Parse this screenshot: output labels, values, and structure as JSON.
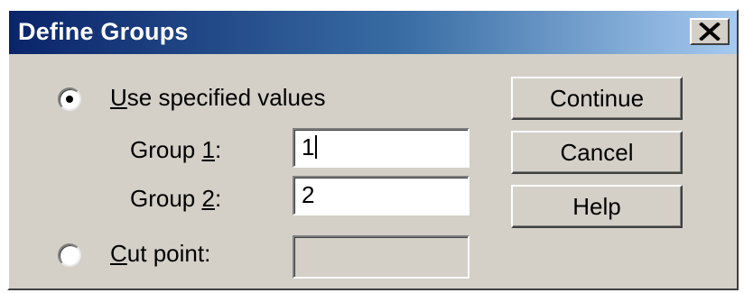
{
  "window": {
    "title": "Define Groups",
    "close_glyph": "✕"
  },
  "options": {
    "use_specified": {
      "label_mnemonic": "U",
      "label_rest": "se specified values",
      "selected": true
    },
    "cut_point": {
      "label_mnemonic": "C",
      "label_rest": "ut point:",
      "selected": false,
      "value": ""
    }
  },
  "groups": {
    "group1": {
      "label_prefix": "Group ",
      "label_mnemonic": "1",
      "label_suffix": ":",
      "value": "1"
    },
    "group2": {
      "label_prefix": "Group ",
      "label_mnemonic": "2",
      "label_suffix": ":",
      "value": "2"
    }
  },
  "buttons": {
    "continue": "Continue",
    "cancel": "Cancel",
    "help": "Help"
  },
  "colors": {
    "title_gradient_start": "#0a246a",
    "title_gradient_end": "#a6caf0",
    "dialog_face": "#d4d0c8"
  }
}
